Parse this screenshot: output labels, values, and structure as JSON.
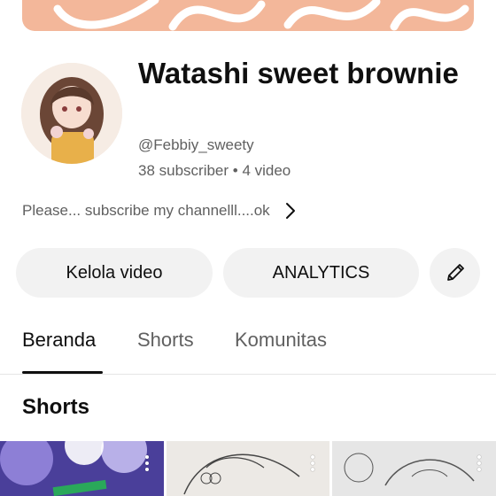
{
  "channel": {
    "name": "Watashi sweet brownie",
    "handle": "@Febbiy_sweety",
    "stats": "38 subscriber • 4 video",
    "description": "Please... subscribe my channelll....ok"
  },
  "actions": {
    "manage_videos": "Kelola video",
    "analytics": "ANALYTICS"
  },
  "tabs": [
    {
      "label": "Beranda",
      "active": true
    },
    {
      "label": "Shorts",
      "active": false
    },
    {
      "label": "Komunitas",
      "active": false
    }
  ],
  "section": {
    "title": "Shorts"
  },
  "colors": {
    "banner": "#f3b79a",
    "button_bg": "#f2f2f2",
    "secondary_text": "#606060",
    "primary_text": "#0f0f0f"
  },
  "icons": {
    "description_more": "chevron-right-icon",
    "edit": "pencil-icon",
    "short_menu": "more-vertical-icon"
  }
}
